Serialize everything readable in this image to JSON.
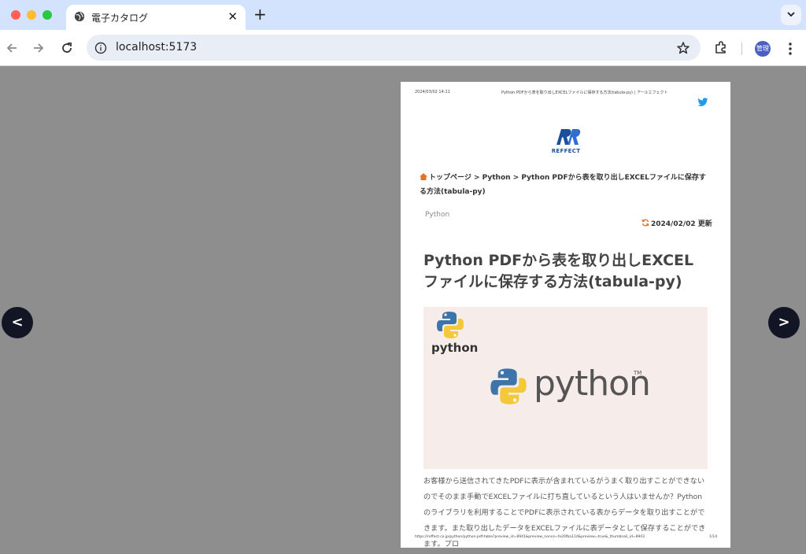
{
  "browser": {
    "tab_title": "電子カタログ",
    "tab_close": "✕",
    "new_tab": "+",
    "url": "localhost:5173",
    "profile_label": "管理"
  },
  "viewer": {
    "prev_label": "<",
    "next_label": ">"
  },
  "page": {
    "header_date": "2024/03/02 14:11",
    "header_title": "Python PDFから表を取り出しEXCELファイルに保存する方法(tabula-py) | アールエフェクト",
    "logo_text": "REFFECT",
    "breadcrumb": "トップページ > Python > Python PDFから表を取り出しEXCELファイルに保存する方法(tabula-py)",
    "category": "Python",
    "updated": "2024/02/02 更新",
    "title": "Python PDFから表を取り出しEXCELファイルに保存する方法(tabula-py)",
    "hero_small_text": "python",
    "hero_big_text": "python",
    "hero_tm": "TM",
    "body": "お客様から送信されてきたPDFに表示が含まれているがうまく取り出すことができないのでそのまま手動でEXCELファイルに打ち直しているという人はいませんか？Pythonのライブラリを利用することでPDFに表示されている表からデータを取り出すことができます。また取り出したデータをEXCELファイルに表データとして保存することができます。プロ",
    "footer_url": "https://reffect.co.jp/python/python-pdf-table?preview_id=8941&preview_nonce=fe20fba11d&preview=true&_thumbnail_id=8943",
    "footer_page": "1/14"
  },
  "colors": {
    "tabbar": "#d3e3fd",
    "viewer_bg": "#8e8e8e",
    "nav_circle": "#121624",
    "hero_bg": "#f6ecea",
    "brand_blue": "#1a4f9c"
  }
}
